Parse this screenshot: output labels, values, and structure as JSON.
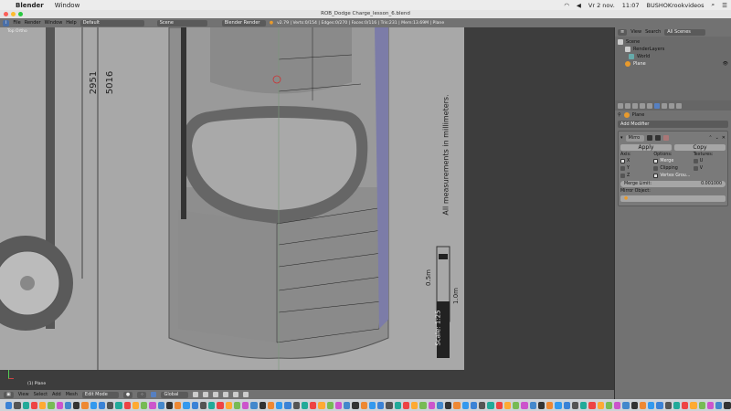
{
  "menubar": {
    "app": "Blender",
    "items": [
      "Window"
    ],
    "date": "Vr 2 nov.",
    "time": "11:07",
    "user": "BUSHOKrookvideos"
  },
  "window": {
    "title": "ROB_Dodge Charge_lesson_6.blend"
  },
  "info_header": {
    "menus": [
      "File",
      "Render",
      "Window",
      "Help"
    ],
    "layout": "Default",
    "scene": "Scene",
    "engine": "Blender Render",
    "stats": "v2.79 | Verts:0/154 | Edges:0/270 | Faces:0/116 | Tris:231 | Mem:13.69M | Plane"
  },
  "viewport": {
    "view_label": "Top Ortho",
    "object_label": "(1) Plane",
    "blueprint": {
      "dim1": "2951",
      "dim2": "5016",
      "note": "All measurements in millimeters.",
      "scale_half": "0.5m",
      "scale_full": "1.0m",
      "scale": "Scale: 1:25"
    }
  },
  "outliner": {
    "view": "View",
    "search": "Search",
    "filter": "All Scenes",
    "items": [
      "Scene",
      "RenderLayers",
      "World",
      "Plane"
    ]
  },
  "properties": {
    "object": "Plane",
    "add_modifier": "Add Modifier",
    "modifier_name": "Mirro",
    "apply": "Apply",
    "copy": "Copy",
    "axis_label": "Axis:",
    "options_label": "Options:",
    "textures_label": "Textures:",
    "axes": [
      {
        "label": "X",
        "checked": true
      },
      {
        "label": "Y",
        "checked": false
      },
      {
        "label": "Z",
        "checked": false
      }
    ],
    "options": [
      {
        "label": "Merge",
        "checked": true
      },
      {
        "label": "Clipping",
        "checked": false
      },
      {
        "label": "Vertex Grou...",
        "checked": true
      }
    ],
    "textures": [
      {
        "label": "U",
        "checked": false
      },
      {
        "label": "V",
        "checked": false
      }
    ],
    "merge_limit_label": "Merge Limit:",
    "merge_limit": "0.001000",
    "mirror_object_label": "Mirror Object:"
  },
  "bottom_header": {
    "menus": [
      "View",
      "Select",
      "Add",
      "Mesh"
    ],
    "mode": "Edit Mode",
    "orientation": "Global"
  }
}
